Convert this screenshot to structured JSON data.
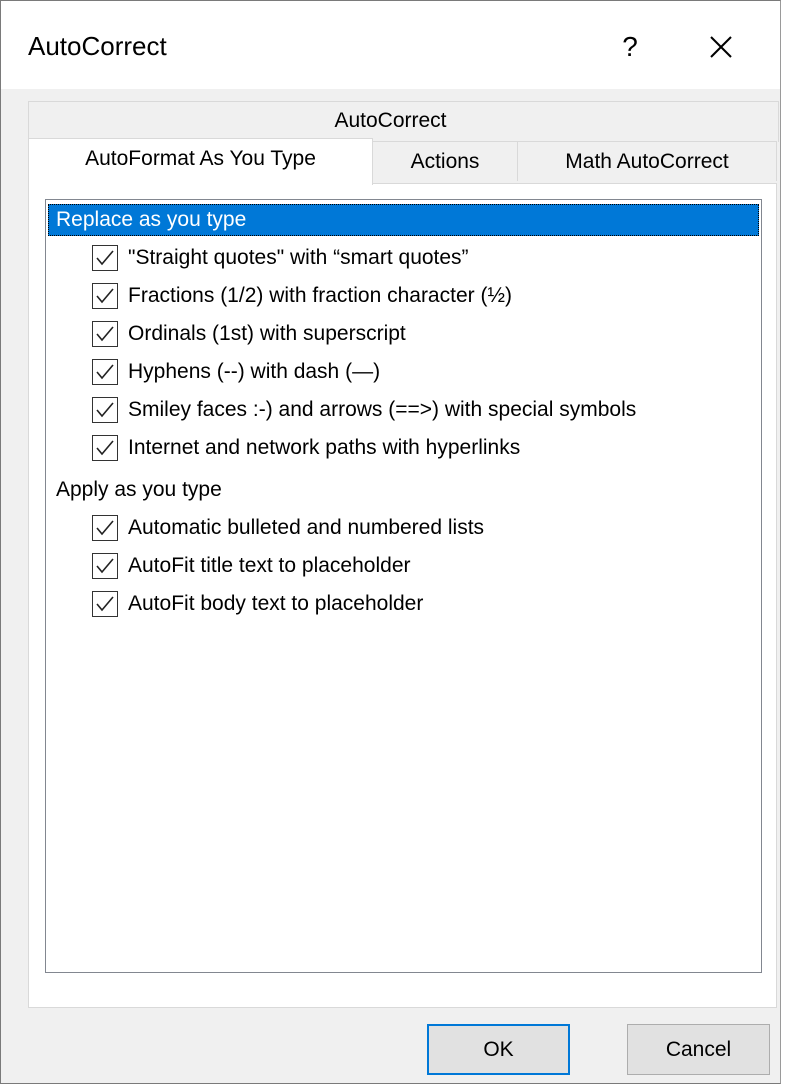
{
  "window": {
    "title": "AutoCorrect",
    "help_label": "?",
    "close_icon": "close-icon"
  },
  "tabs": {
    "back_row": [
      "AutoCorrect"
    ],
    "front_row": [
      {
        "label": "AutoFormat As You Type",
        "active": true
      },
      {
        "label": "Actions",
        "active": false
      },
      {
        "label": "Math AutoCorrect",
        "active": false
      }
    ]
  },
  "groups": [
    {
      "header": "Replace as you type",
      "selected": true,
      "options": [
        {
          "label": "\"Straight quotes\" with “smart quotes”",
          "checked": true
        },
        {
          "label": "Fractions (1/2) with fraction character (½)",
          "checked": true
        },
        {
          "label": "Ordinals (1st) with superscript",
          "checked": true
        },
        {
          "label": "Hyphens (--) with dash (—)",
          "checked": true
        },
        {
          "label": "Smiley faces :-) and arrows (==>) with special symbols",
          "checked": true
        },
        {
          "label": "Internet and network paths with hyperlinks",
          "checked": true
        }
      ]
    },
    {
      "header": "Apply as you type",
      "selected": false,
      "options": [
        {
          "label": "Automatic bulleted and numbered lists",
          "checked": true
        },
        {
          "label": "AutoFit title text to placeholder",
          "checked": true
        },
        {
          "label": "AutoFit body text to placeholder",
          "checked": true
        }
      ]
    }
  ],
  "buttons": {
    "ok": "OK",
    "cancel": "Cancel"
  },
  "colors": {
    "selection": "#0078d7",
    "dialog_bg": "#f0f0f0"
  }
}
